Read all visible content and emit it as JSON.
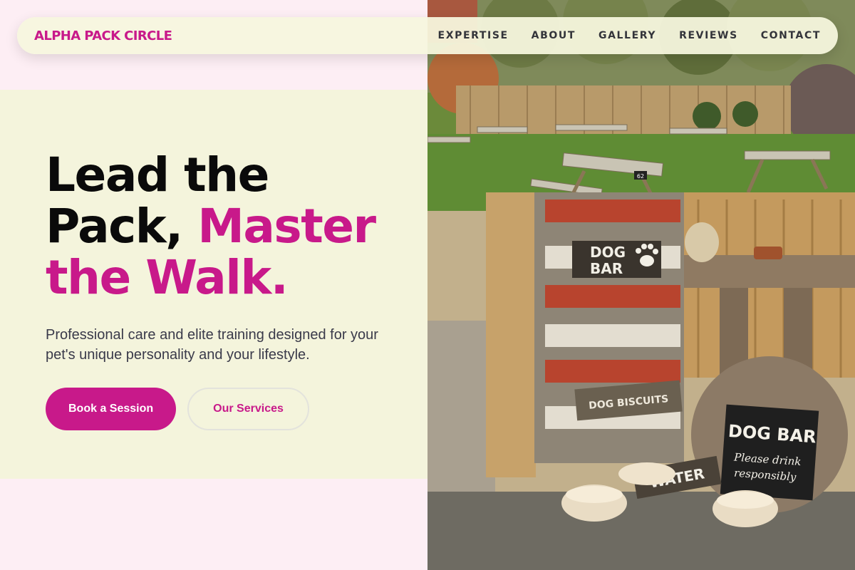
{
  "brand": {
    "name": "ALPHA PACK CIRCLE"
  },
  "nav": {
    "links": [
      "EXPERTISE",
      "ABOUT",
      "GALLERY",
      "REVIEWS",
      "CONTACT"
    ]
  },
  "hero": {
    "headline_part1": "Lead the Pack, ",
    "headline_part2": "Master the Walk.",
    "subtext": "Professional care and elite training designed for your pet's unique personality and your lifestyle.",
    "primary_cta": "Book a Session",
    "secondary_cta": "Our Services"
  },
  "photo": {
    "signs": {
      "dog_bar_top_line1": "DOG",
      "dog_bar_top_line2": "BAR",
      "dog_biscuits": "DOG BISCUITS",
      "water": "WATER",
      "dog_bar_main": "DOG BAR",
      "please_drink_line1": "Please drink",
      "please_drink_line2": "responsibly",
      "table_number": "62"
    }
  },
  "colors": {
    "accent": "#c8198a",
    "page_bg": "#fdeef4",
    "panel_bg": "#f4f4dc",
    "nav_bg": "#f6f6de"
  }
}
